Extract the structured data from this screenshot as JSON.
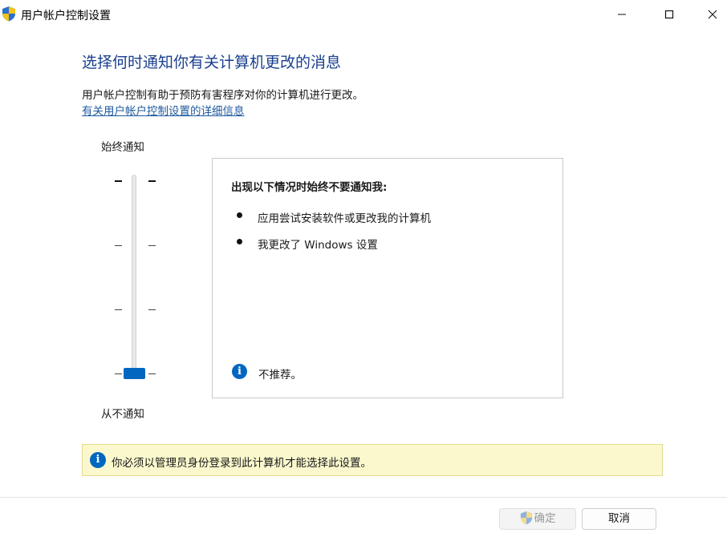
{
  "window": {
    "title": "用户帐户控制设置",
    "icon": "uac-shield-icon",
    "controls": [
      "minimize-icon",
      "maximize-icon",
      "close-icon"
    ]
  },
  "main": {
    "heading": "选择何时通知你有关计算机更改的消息",
    "description": "用户帐户控制有助于预防有害程序对你的计算机进行更改。",
    "details_link": "有关用户帐户控制设置的详细信息"
  },
  "slider": {
    "top_label": "始终通知",
    "bottom_label": "从不通知",
    "levels": 4,
    "selected_level": 1
  },
  "panel": {
    "heading": "出现以下情况时始终不要通知我:",
    "bullets": [
      "应用尝试安装软件或更改我的计算机",
      "我更改了 Windows 设置"
    ],
    "recommendation_icon": "i",
    "recommendation": "不推荐。"
  },
  "admin_notice": {
    "icon": "i",
    "text": "你必须以管理员身份登录到此计算机才能选择此设置。"
  },
  "buttons": {
    "ok": "确定",
    "ok_enabled": false,
    "cancel": "取消"
  },
  "colors": {
    "heading": "#1a3f8f",
    "link": "#1f5a9e",
    "accent": "#0067c0",
    "notice_bg": "#fbf8cd"
  }
}
